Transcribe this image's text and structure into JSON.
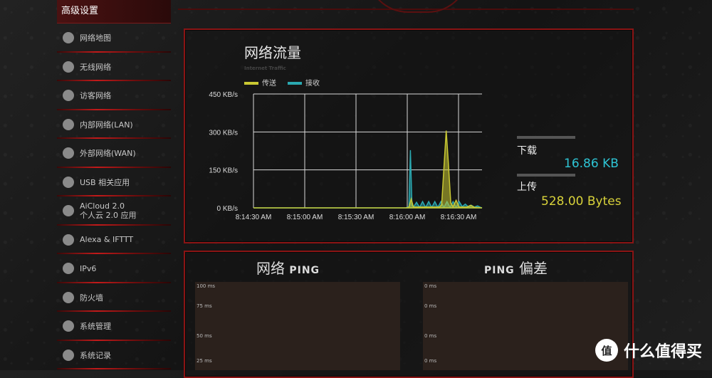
{
  "sidebar": {
    "header": "高级设置",
    "items": [
      {
        "label": "网络地图",
        "icon": "globe-icon"
      },
      {
        "label": "无线网络",
        "icon": "wifi-icon"
      },
      {
        "label": "访客网络",
        "icon": "guest-globe-icon"
      },
      {
        "label": "内部网络(LAN)",
        "icon": "lan-icon"
      },
      {
        "label": "外部网络(WAN)",
        "icon": "wan-globe-icon"
      },
      {
        "label": "USB 相关应用",
        "icon": "usb-icon"
      },
      {
        "label": "AiCloud 2.0",
        "label2": "个人云 2.0 应用",
        "icon": "cloud-icon"
      },
      {
        "label": "Alexa & IFTTT",
        "icon": "alexa-icon"
      },
      {
        "label": "IPv6",
        "icon": "ipv6-icon"
      },
      {
        "label": "防火墙",
        "icon": "firewall-icon"
      },
      {
        "label": "系统管理",
        "icon": "admin-icon"
      },
      {
        "label": "系统记录",
        "icon": "log-icon"
      }
    ]
  },
  "traffic": {
    "title": "网络流量",
    "subtitle": "Internet Traffic",
    "legend": [
      {
        "name": "传送",
        "color": "#c9c832"
      },
      {
        "name": "接收",
        "color": "#2aa8b0"
      }
    ],
    "download_label": "下载",
    "download_value": "16.86 KB",
    "upload_label": "上传",
    "upload_value": "528.00 Bytes",
    "download_color": "#2ec4d4",
    "upload_color": "#d8d23a"
  },
  "chart_data": {
    "type": "line",
    "x": [
      "8:14:30 AM",
      "8:15:00 AM",
      "8:15:30 AM",
      "8:16:00 AM",
      "8:16:30 AM"
    ],
    "yticks": [
      "450 KB/s",
      "300 KB/s",
      "150 KB/s",
      "0 KB/s"
    ],
    "ylim": [
      0,
      450
    ],
    "grid": true,
    "series": [
      {
        "name": "接收",
        "color": "#2aa8b0",
        "points": [
          [
            0,
            0
          ],
          [
            200,
            0
          ],
          [
            204,
            5
          ],
          [
            206,
            228
          ],
          [
            208,
            10
          ],
          [
            210,
            3
          ],
          [
            214,
            22
          ],
          [
            218,
            2
          ],
          [
            222,
            25
          ],
          [
            226,
            2
          ],
          [
            230,
            25
          ],
          [
            234,
            2
          ],
          [
            238,
            25
          ],
          [
            242,
            2
          ],
          [
            246,
            25
          ],
          [
            250,
            2
          ],
          [
            254,
            25
          ],
          [
            258,
            2
          ],
          [
            262,
            25
          ],
          [
            266,
            2
          ],
          [
            270,
            25
          ],
          [
            274,
            5
          ],
          [
            278,
            15
          ],
          [
            282,
            4
          ],
          [
            286,
            10
          ],
          [
            290,
            3
          ],
          [
            294,
            8
          ],
          [
            298,
            2
          ],
          [
            300,
            0
          ]
        ]
      },
      {
        "name": "传送",
        "color": "#c9c832",
        "points": [
          [
            0,
            0
          ],
          [
            200,
            0
          ],
          [
            204,
            2
          ],
          [
            207,
            35
          ],
          [
            210,
            3
          ],
          [
            244,
            3
          ],
          [
            247,
            12
          ],
          [
            250,
            160
          ],
          [
            253,
            305
          ],
          [
            256,
            170
          ],
          [
            259,
            20
          ],
          [
            262,
            4
          ],
          [
            266,
            30
          ],
          [
            270,
            3
          ],
          [
            280,
            3
          ],
          [
            285,
            10
          ],
          [
            290,
            2
          ],
          [
            300,
            0
          ]
        ]
      }
    ]
  },
  "ping": {
    "left_title": "网络",
    "left_title_sc": "PING",
    "right_title_sc": "PING",
    "right_title": "偏差",
    "left_ticks": [
      "100 ms",
      "75 ms",
      "50 ms",
      "25 ms"
    ],
    "right_ticks": [
      "0 ms",
      "0 ms",
      "0 ms",
      "0 ms"
    ]
  },
  "watermark": {
    "logo": "值",
    "text": "什么值得买"
  }
}
